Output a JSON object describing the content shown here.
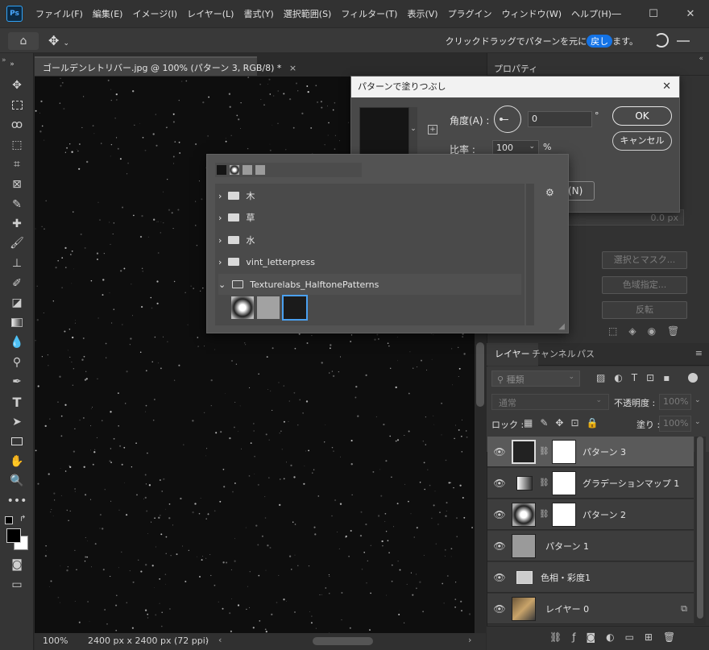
{
  "app": {
    "logo": "Ps"
  },
  "menu": [
    "ファイル(F)",
    "編集(E)",
    "イメージ(I)",
    "レイヤー(L)",
    "書式(Y)",
    "選択範囲(S)",
    "フィルター(T)",
    "表示(V)",
    "プラグイン",
    "ウィンドウ(W)",
    "ヘルプ(H)"
  ],
  "options": {
    "hint_pre": "クリックドラッグでパターンを元に",
    "hint_highlight": "戻し",
    "hint_post": "ます。"
  },
  "document": {
    "tab": "ゴールデンレトリバー.jpg @ 100% (パターン 3, RGB/8) *",
    "zoom": "100%",
    "size": "2400 px x 2400 px (72 ppi)"
  },
  "properties": {
    "tab": "プロパティ",
    "feather_value": "0.0 px",
    "select_mask": "選択とマスク...",
    "color_range": "色域指定...",
    "invert": "反転"
  },
  "fill_dialog": {
    "title": "パターンで塗りつぶし",
    "angle_label": "角度(A) :",
    "angle_value": "0",
    "angle_unit": "°",
    "scale_label": "比率 :",
    "scale_value": "100",
    "scale_unit": "%",
    "ok": "OK",
    "cancel": "キャンセル",
    "n_label": "(N)"
  },
  "picker": {
    "folders": [
      {
        "name": "木",
        "expanded": false
      },
      {
        "name": "草",
        "expanded": false
      },
      {
        "name": "水",
        "expanded": false
      },
      {
        "name": "vint_letterpress",
        "expanded": false
      },
      {
        "name": "Texturelabs_HalftonePatterns",
        "expanded": true
      }
    ]
  },
  "layers": {
    "tabs": [
      "レイヤー",
      "チャンネル",
      "パス"
    ],
    "search_placeholder": "種類",
    "blend_mode": "通常",
    "opacity_label": "不透明度 :",
    "opacity_value": "100%",
    "lock_label": "ロック :",
    "fill_label": "塗り :",
    "fill_value": "100%",
    "items": [
      {
        "name": "パターン 3"
      },
      {
        "name": "グラデーションマップ 1"
      },
      {
        "name": "パターン 2"
      },
      {
        "name": "パターン 1"
      },
      {
        "name": "色相・彩度1"
      },
      {
        "name": "レイヤー 0"
      }
    ]
  },
  "colors": {
    "accent": "#1473e6",
    "selected_layer": "#5a5a5a"
  }
}
